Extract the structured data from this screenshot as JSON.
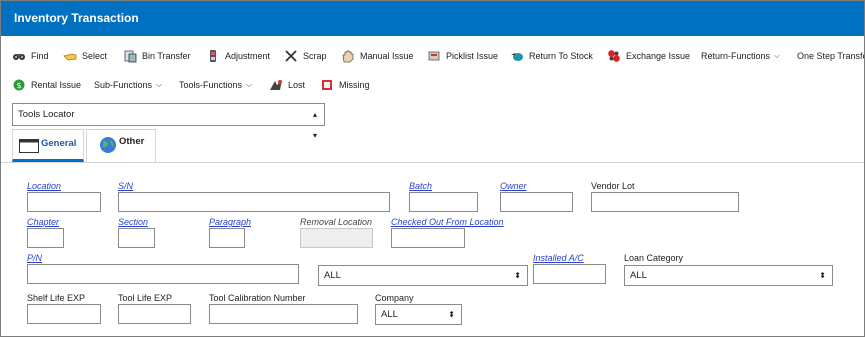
{
  "window": {
    "title": "Inventory Transaction"
  },
  "toolbar": {
    "row1": [
      {
        "label": "Find",
        "icon": "binoculars-icon"
      },
      {
        "label": "Select",
        "icon": "pointing-hand-icon"
      },
      {
        "label": "Bin Transfer",
        "icon": "bin-transfer-icon"
      },
      {
        "label": "Adjustment",
        "icon": "adjustment-icon"
      },
      {
        "label": "Scrap",
        "icon": "scissors-icon"
      },
      {
        "label": "Manual Issue",
        "icon": "hand-icon"
      },
      {
        "label": "Picklist Issue",
        "icon": "picklist-icon"
      },
      {
        "label": "Return To Stock",
        "icon": "return-stock-icon"
      },
      {
        "label": "Exchange Issue",
        "icon": "exchange-icon"
      },
      {
        "label": "Return-Functions",
        "icon": ""
      },
      {
        "label": "One Step Transfe",
        "icon": ""
      }
    ],
    "row2": [
      {
        "label": "Rental Issue",
        "icon": "money-icon"
      },
      {
        "label": "Sub-Functions",
        "icon": ""
      },
      {
        "label": "Tools-Functions",
        "icon": ""
      },
      {
        "label": "Lost",
        "icon": "lost-icon"
      },
      {
        "label": "Missing",
        "icon": "missing-icon"
      }
    ]
  },
  "locator": {
    "selected": "Tools Locator"
  },
  "tabs": {
    "general": "General",
    "other": "Other"
  },
  "form": {
    "location": "Location",
    "sn": "S/N",
    "batch": "Batch",
    "owner": "Owner",
    "vendor_lot": "Vendor Lot",
    "chapter": "Chapter",
    "section": "Section",
    "paragraph": "Paragraph",
    "removal_location": "Removal Location",
    "checked_out_from": "Checked Out From Location",
    "pn": "P/N",
    "pn_type_value": "ALL",
    "installed_ac": "Installed A/C",
    "loan_category": "Loan Category",
    "loan_category_value": "ALL",
    "shelf_life_exp": "Shelf Life EXP",
    "tool_life_exp": "Tool Life EXP",
    "tool_calibration_number": "Tool Calibration Number",
    "company": "Company",
    "company_value": "ALL"
  },
  "colors": {
    "titlebar": "#0070c0",
    "link_label": "#2a42c9"
  }
}
